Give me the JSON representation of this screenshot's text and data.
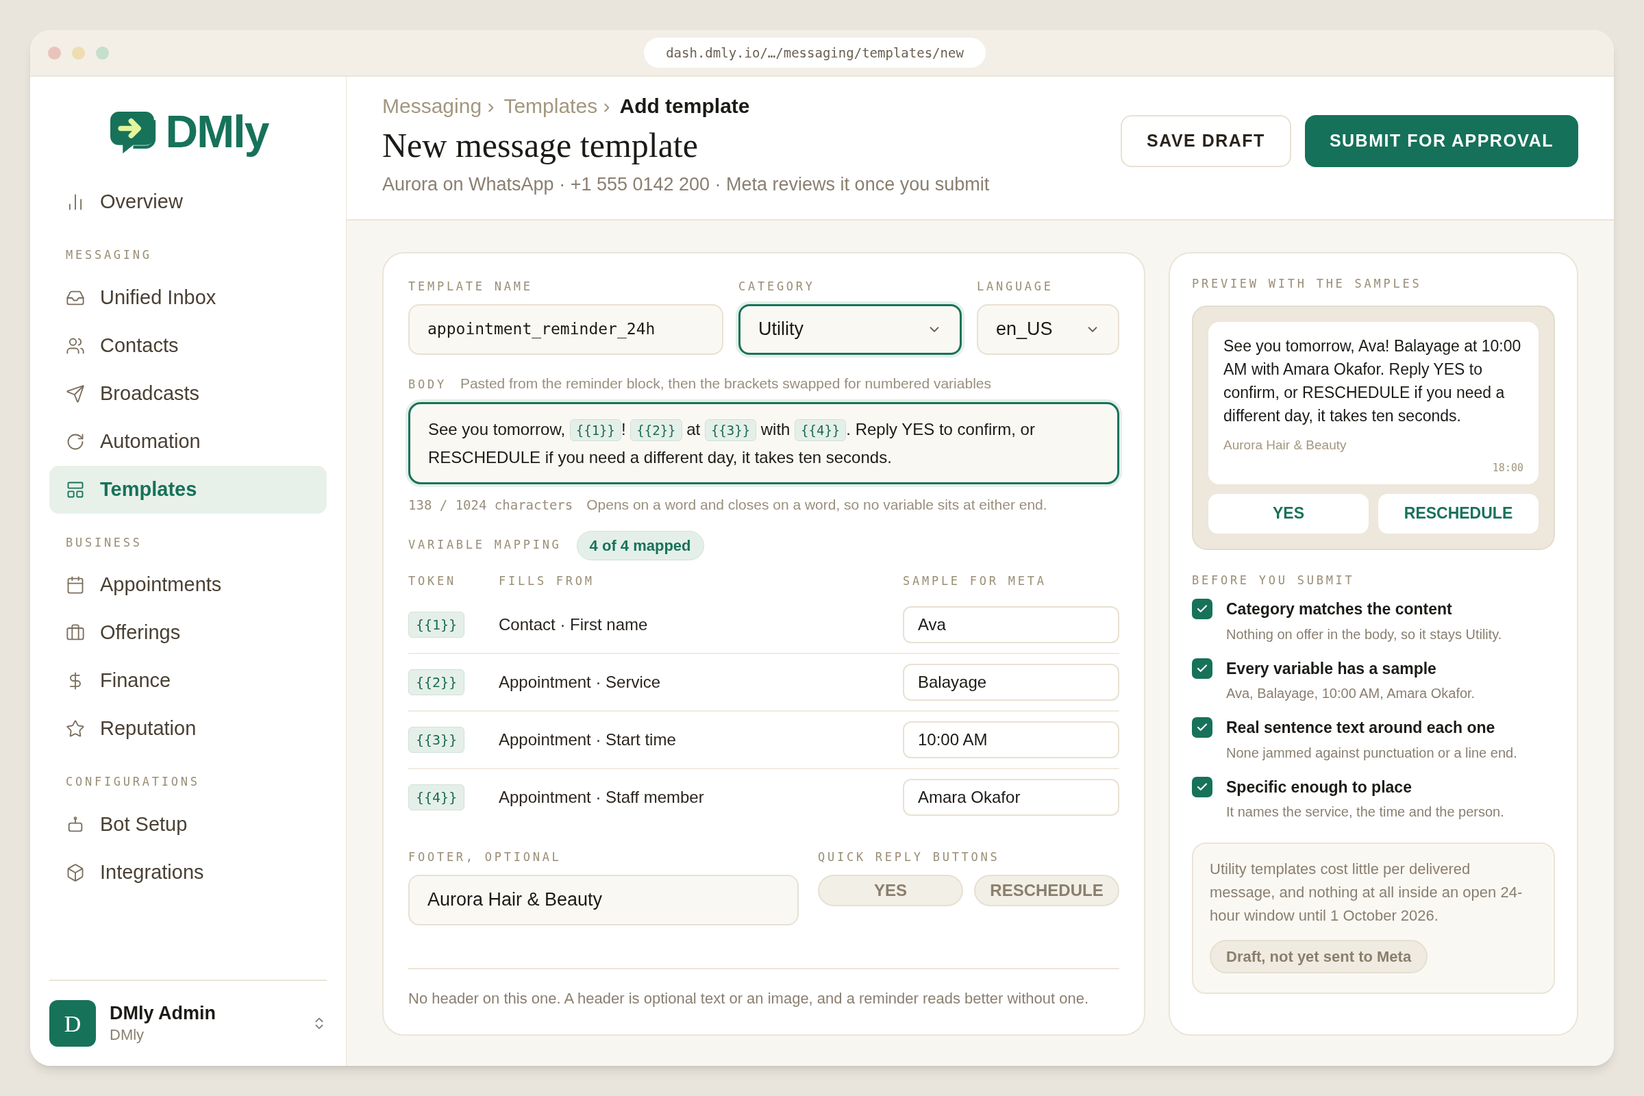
{
  "browser": {
    "url": "dash.dmly.io/…/messaging/templates/new"
  },
  "sidebar": {
    "logo": "DMly",
    "sections": [
      {
        "items": [
          {
            "label": "Overview",
            "selected": false
          }
        ]
      },
      {
        "title": "MESSAGING",
        "items": [
          {
            "label": "Unified Inbox",
            "selected": false
          },
          {
            "label": "Contacts",
            "selected": false
          },
          {
            "label": "Broadcasts",
            "selected": false
          },
          {
            "label": "Automation",
            "selected": false
          },
          {
            "label": "Templates",
            "selected": true
          }
        ]
      },
      {
        "title": "BUSINESS",
        "items": [
          {
            "label": "Appointments",
            "selected": false
          },
          {
            "label": "Offerings",
            "selected": false
          },
          {
            "label": "Finance",
            "selected": false
          },
          {
            "label": "Reputation",
            "selected": false
          }
        ]
      },
      {
        "title": "CONFIGURATIONS",
        "items": [
          {
            "label": "Bot Setup",
            "selected": false
          },
          {
            "label": "Integrations",
            "selected": false
          }
        ]
      }
    ],
    "account": {
      "initial": "D",
      "name": "DMly Admin",
      "org": "DMly"
    }
  },
  "header": {
    "breadcrumbs": [
      {
        "label": "Messaging",
        "separator": "›",
        "current": false
      },
      {
        "label": "Templates",
        "separator": "›",
        "current": false
      },
      {
        "label": "Add template",
        "current": true
      }
    ],
    "title": "New message template",
    "subtitle": "Aurora on WhatsApp · +1 555 0142 200 · Meta reviews it once you submit",
    "buttons": [
      {
        "label": "SAVE DRAFT",
        "kind": "secondary"
      },
      {
        "label": "SUBMIT FOR APPROVAL",
        "kind": "primary"
      }
    ]
  },
  "form": {
    "template_name": {
      "label": "TEMPLATE NAME",
      "value": "appointment_reminder_24h",
      "focused": false
    },
    "category": {
      "label": "CATEGORY",
      "value": "Utility",
      "focused": true
    },
    "language": {
      "label": "LANGUAGE",
      "value": "en_US",
      "focused": false
    },
    "body": {
      "label": "BODY",
      "hint": "Pasted from the reminder block, then the brackets swapped for numbered variables",
      "focused": true,
      "segments": [
        {
          "kind": "text",
          "text": "See you tomorrow, "
        },
        {
          "kind": "token",
          "text": "{{1}}"
        },
        {
          "kind": "text",
          "text": "! "
        },
        {
          "kind": "token",
          "text": "{{2}}"
        },
        {
          "kind": "text",
          "text": " at "
        },
        {
          "kind": "token",
          "text": "{{3}}"
        },
        {
          "kind": "text",
          "text": " with "
        },
        {
          "kind": "token",
          "text": "{{4}}"
        },
        {
          "kind": "text",
          "text": ". Reply YES to confirm, or RESCHEDULE if you need a different day, it takes ten seconds."
        }
      ],
      "counter": "138 / 1024 characters",
      "note": "Opens on a word and closes on a word, so no variable sits at either end."
    },
    "mapping": {
      "label": "VARIABLE MAPPING",
      "badge": "4 of 4 mapped",
      "columns": [
        "TOKEN",
        "FILLS FROM",
        "SAMPLE FOR META"
      ],
      "rows": [
        {
          "token": "{{1}}",
          "fills_from": "Contact · First name",
          "sample": "Ava"
        },
        {
          "token": "{{2}}",
          "fills_from": "Appointment · Service",
          "sample": "Balayage"
        },
        {
          "token": "{{3}}",
          "fills_from": "Appointment · Start time",
          "sample": "10:00 AM"
        },
        {
          "token": "{{4}}",
          "fills_from": "Appointment · Staff member",
          "sample": "Amara Okafor"
        }
      ]
    },
    "footer": {
      "label": "FOOTER, OPTIONAL",
      "value": "Aurora Hair & Beauty"
    },
    "quick_replies": {
      "label": "QUICK REPLY BUTTONS",
      "buttons": [
        "YES",
        "RESCHEDULE"
      ]
    },
    "note": "No header on this one. A header is optional text or an image, and a reminder reads better without one."
  },
  "preview": {
    "title": "PREVIEW WITH THE SAMPLES",
    "message": "See you tomorrow, Ava! Balayage at 10:00 AM with Amara Okafor. Reply YES to confirm, or RESCHEDULE if you need a different day, it takes ten seconds.",
    "footer": "Aurora Hair & Beauty",
    "time": "18:00",
    "buttons": [
      "YES",
      "RESCHEDULE"
    ]
  },
  "checklist": {
    "title": "BEFORE YOU SUBMIT",
    "items": [
      {
        "title": "Category matches the content",
        "detail": "Nothing on offer in the body, so it stays Utility.",
        "checked": true
      },
      {
        "title": "Every variable has a sample",
        "detail": "Ava, Balayage, 10:00 AM, Amara Okafor.",
        "checked": true
      },
      {
        "title": "Real sentence text around each one",
        "detail": "None jammed against punctuation or a line end.",
        "checked": true
      },
      {
        "title": "Specific enough to place",
        "detail": "It names the service, the time and the person.",
        "checked": true
      }
    ]
  },
  "info": {
    "text": "Utility templates cost little per delivered message, and nothing at all inside an open 24-hour window until 1 October 2026.",
    "badge": "Draft, not yet sent to Meta"
  }
}
